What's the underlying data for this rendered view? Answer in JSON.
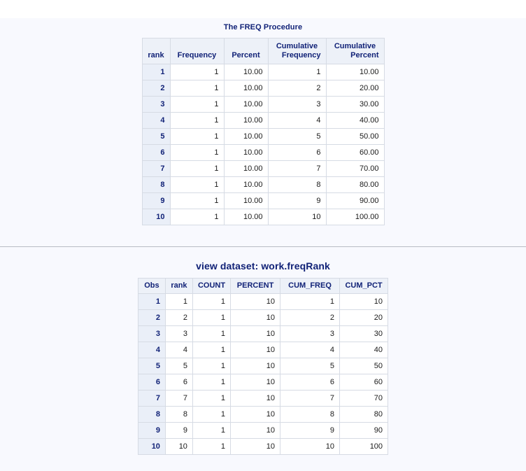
{
  "colors": {
    "page_background": "#f8f9fe",
    "title_text": "#112277",
    "header_background": "#edf1f8",
    "row_header_background": "#eaeff8",
    "cell_text": "#1a1a1a",
    "border": "#d6dbe4",
    "divider": "#b8bcc4"
  },
  "freq_section": {
    "title": "The FREQ Procedure",
    "table": {
      "columns": [
        {
          "key": "rank",
          "line1": "rank",
          "line2": "",
          "align": "center"
        },
        {
          "key": "frequency",
          "line1": "Frequency",
          "line2": "",
          "align": "center"
        },
        {
          "key": "percent",
          "line1": "Percent",
          "line2": "",
          "align": "center"
        },
        {
          "key": "cum_frequency",
          "line1": "Cumulative",
          "line2": "Frequency",
          "align": "right"
        },
        {
          "key": "cum_percent",
          "line1": "Cumulative",
          "line2": "Percent",
          "align": "right"
        }
      ],
      "rows": [
        {
          "rank": "1",
          "frequency": "1",
          "percent": "10.00",
          "cum_frequency": "1",
          "cum_percent": "10.00"
        },
        {
          "rank": "2",
          "frequency": "1",
          "percent": "10.00",
          "cum_frequency": "2",
          "cum_percent": "20.00"
        },
        {
          "rank": "3",
          "frequency": "1",
          "percent": "10.00",
          "cum_frequency": "3",
          "cum_percent": "30.00"
        },
        {
          "rank": "4",
          "frequency": "1",
          "percent": "10.00",
          "cum_frequency": "4",
          "cum_percent": "40.00"
        },
        {
          "rank": "5",
          "frequency": "1",
          "percent": "10.00",
          "cum_frequency": "5",
          "cum_percent": "50.00"
        },
        {
          "rank": "6",
          "frequency": "1",
          "percent": "10.00",
          "cum_frequency": "6",
          "cum_percent": "60.00"
        },
        {
          "rank": "7",
          "frequency": "1",
          "percent": "10.00",
          "cum_frequency": "7",
          "cum_percent": "70.00"
        },
        {
          "rank": "8",
          "frequency": "1",
          "percent": "10.00",
          "cum_frequency": "8",
          "cum_percent": "80.00"
        },
        {
          "rank": "9",
          "frequency": "1",
          "percent": "10.00",
          "cum_frequency": "9",
          "cum_percent": "90.00"
        },
        {
          "rank": "10",
          "frequency": "1",
          "percent": "10.00",
          "cum_frequency": "10",
          "cum_percent": "100.00"
        }
      ]
    }
  },
  "dataset_section": {
    "title": "view dataset: work.freqRank",
    "table": {
      "columns": [
        {
          "key": "obs",
          "label": "Obs"
        },
        {
          "key": "rank",
          "label": "rank"
        },
        {
          "key": "count",
          "label": "COUNT"
        },
        {
          "key": "percent",
          "label": "PERCENT"
        },
        {
          "key": "cum_freq",
          "label": "CUM_FREQ"
        },
        {
          "key": "cum_pct",
          "label": "CUM_PCT"
        }
      ],
      "rows": [
        {
          "obs": "1",
          "rank": "1",
          "count": "1",
          "percent": "10",
          "cum_freq": "1",
          "cum_pct": "10"
        },
        {
          "obs": "2",
          "rank": "2",
          "count": "1",
          "percent": "10",
          "cum_freq": "2",
          "cum_pct": "20"
        },
        {
          "obs": "3",
          "rank": "3",
          "count": "1",
          "percent": "10",
          "cum_freq": "3",
          "cum_pct": "30"
        },
        {
          "obs": "4",
          "rank": "4",
          "count": "1",
          "percent": "10",
          "cum_freq": "4",
          "cum_pct": "40"
        },
        {
          "obs": "5",
          "rank": "5",
          "count": "1",
          "percent": "10",
          "cum_freq": "5",
          "cum_pct": "50"
        },
        {
          "obs": "6",
          "rank": "6",
          "count": "1",
          "percent": "10",
          "cum_freq": "6",
          "cum_pct": "60"
        },
        {
          "obs": "7",
          "rank": "7",
          "count": "1",
          "percent": "10",
          "cum_freq": "7",
          "cum_pct": "70"
        },
        {
          "obs": "8",
          "rank": "8",
          "count": "1",
          "percent": "10",
          "cum_freq": "8",
          "cum_pct": "80"
        },
        {
          "obs": "9",
          "rank": "9",
          "count": "1",
          "percent": "10",
          "cum_freq": "9",
          "cum_pct": "90"
        },
        {
          "obs": "10",
          "rank": "10",
          "count": "1",
          "percent": "10",
          "cum_freq": "10",
          "cum_pct": "100"
        }
      ]
    }
  }
}
